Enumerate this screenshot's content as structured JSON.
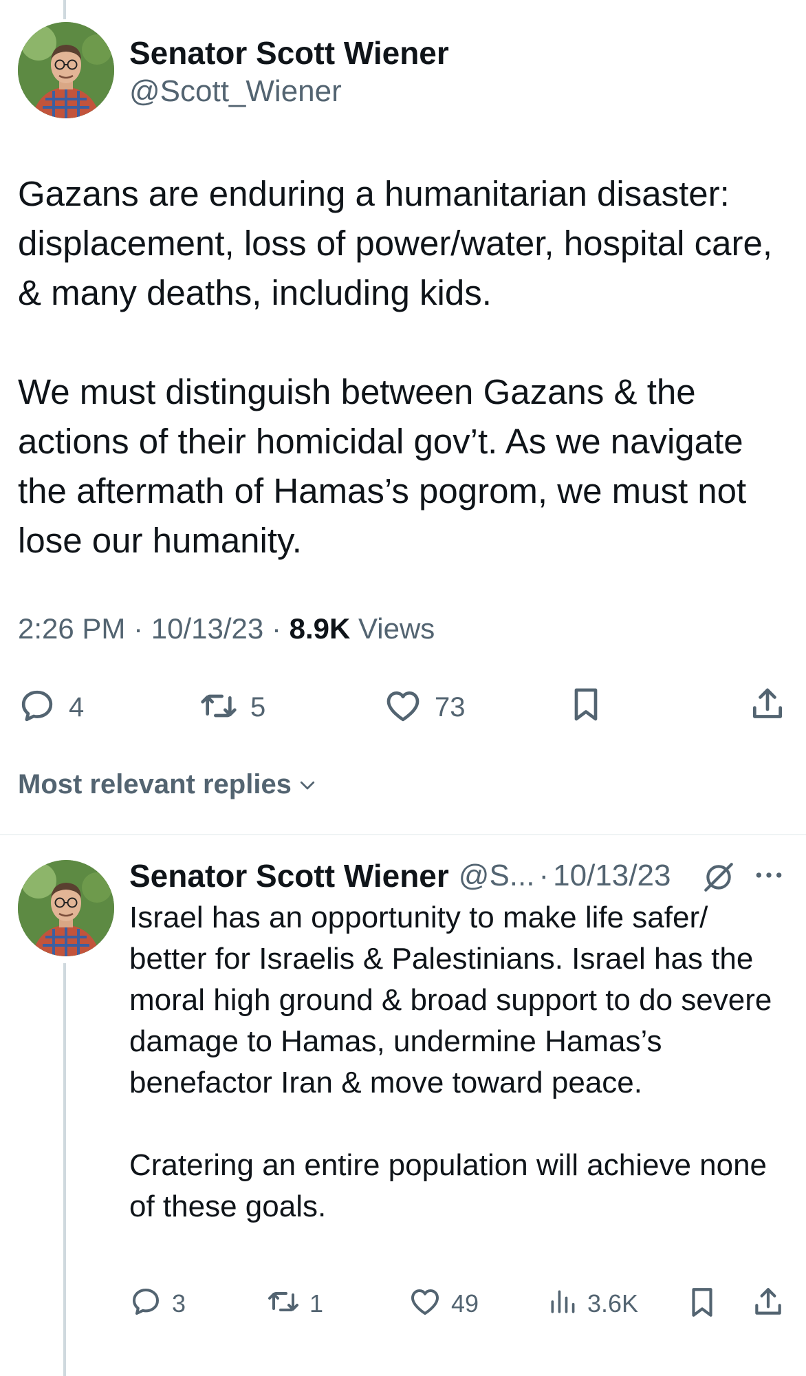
{
  "main_tweet": {
    "author_name": "Senator Scott Wiener",
    "author_handle": "@Scott_Wiener",
    "paragraphs": [
      "Gazans are enduring a humanitarian disaster: displacement, loss of power/water, hospital care, & many deaths, including kids.",
      "We must distinguish between Gazans & the actions of their homicidal gov’t. As we navigate the aftermath of Hamas’s pogrom, we must not lose our humanity."
    ],
    "time": "2:26 PM",
    "date": "10/13/23",
    "views_count": "8.9K",
    "views_label": "Views",
    "separator": "·",
    "actions": {
      "replies": "4",
      "reposts": "5",
      "likes": "73"
    }
  },
  "replies_sort": {
    "label": "Most relevant replies"
  },
  "reply_tweet": {
    "author_name": "Senator Scott Wiener",
    "author_handle": "@S...",
    "separator": "·",
    "date": "10/13/23",
    "paragraphs": [
      "Israel has an opportunity to make life safer/ better for Israelis & Palestinians. Israel has the moral high ground & broad support to do severe damage to Hamas, undermine Hamas’s benefactor Iran & move toward peace.",
      "Cratering an entire population will achieve none of these goals."
    ],
    "actions": {
      "replies": "3",
      "reposts": "1",
      "likes": "49",
      "views": "3.6K"
    }
  },
  "colors": {
    "text_primary": "#0f1419",
    "text_secondary": "#536471",
    "thread_line": "#cfd9de",
    "divider": "#eff3f4"
  },
  "icons": [
    "reply-icon",
    "repost-icon",
    "like-icon",
    "bookmark-icon",
    "share-icon",
    "views-icon",
    "grok-icon",
    "more-icon",
    "chevron-down-icon"
  ]
}
